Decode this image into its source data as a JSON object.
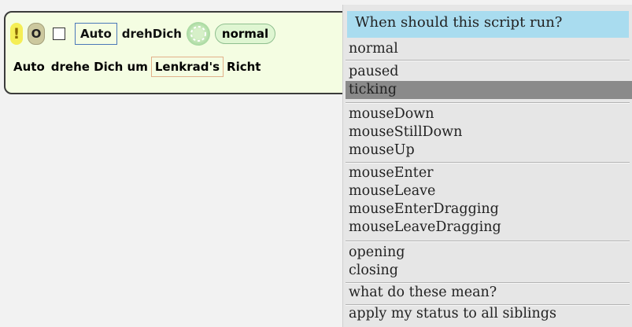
{
  "editor": {
    "bang": "!",
    "status_symbol": "O",
    "auto_label": "Auto",
    "script_name": "drehDich",
    "status_pill": "normal",
    "statement": {
      "receiver": "Auto",
      "verb": "drehe Dich um",
      "argument": "Lenkrad's",
      "rest": "Richt"
    }
  },
  "menu": {
    "title": "When should this script run?",
    "groups": [
      [
        "normal"
      ],
      [
        "paused",
        "ticking"
      ],
      [
        "mouseDown",
        "mouseStillDown",
        "mouseUp"
      ],
      [
        "mouseEnter",
        "mouseLeave",
        "mouseEnterDragging",
        "mouseLeaveDragging"
      ],
      [
        "opening",
        "closing"
      ],
      [
        "what do these mean?"
      ],
      [
        "apply my status to all siblings"
      ]
    ],
    "highlighted": "ticking"
  }
}
